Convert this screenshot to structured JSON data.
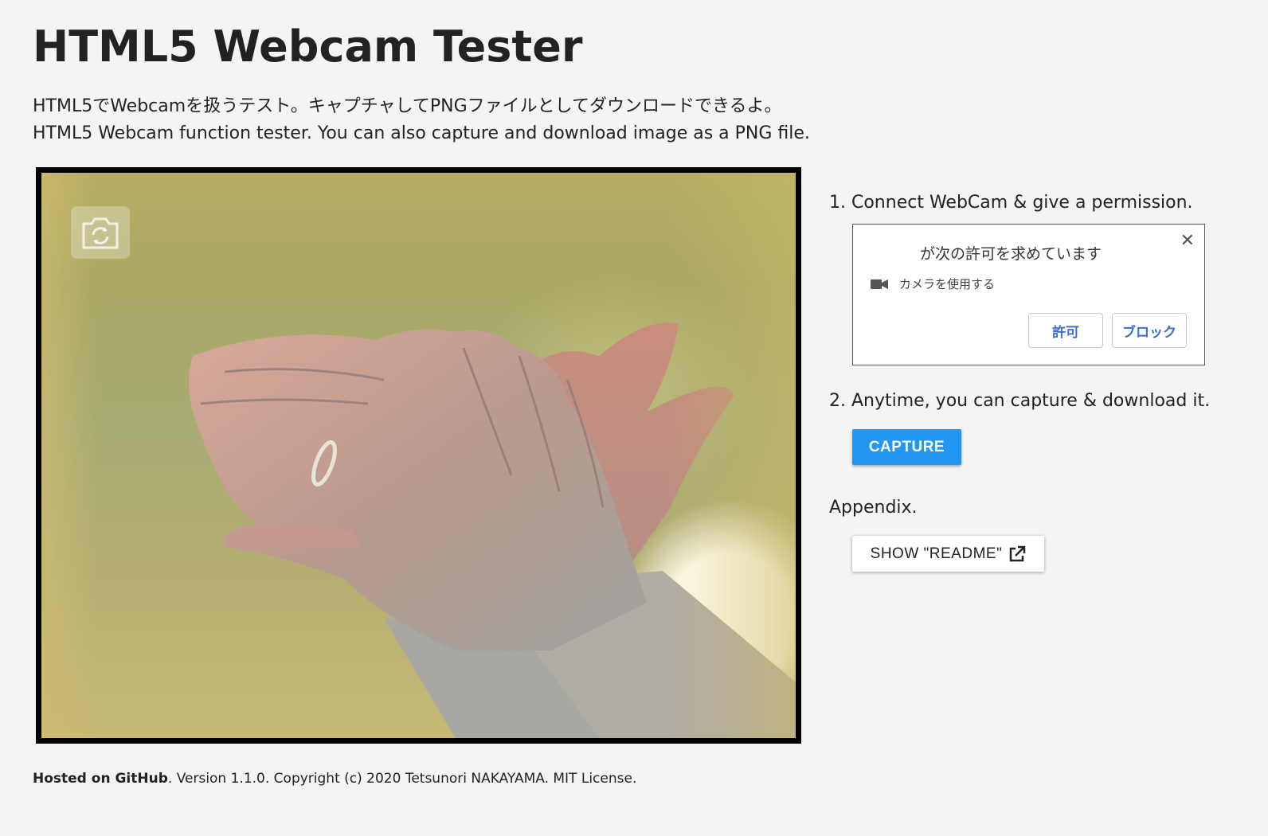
{
  "header": {
    "title": "HTML5 Webcam Tester",
    "description_ja": "HTML5でWebcamを扱うテスト。キャプチャしてPNGファイルとしてダウンロードできるよ。",
    "description_en": "HTML5 Webcam function tester. You can also capture and download image as a PNG file."
  },
  "video": {
    "camera_switch_icon": "camera-switch-icon"
  },
  "steps": {
    "step1": "1. Connect WebCam & give a permission.",
    "step2": "2. Anytime, you can capture & download it.",
    "appendix": "Appendix."
  },
  "permission_dialog": {
    "title": "が次の許可を求めています",
    "close": "✕",
    "item": "カメラを使用する",
    "allow": "許可",
    "block": "ブロック"
  },
  "buttons": {
    "capture": "CAPTURE",
    "readme": "SHOW \"README\""
  },
  "footer": {
    "link": "Hosted on GitHub",
    "text": ". Version 1.1.0. Copyright (c) 2020 Tetsunori NAKAYAMA. MIT License."
  },
  "colors": {
    "accent": "#2196f3",
    "background": "#f4f4f4",
    "dialog_link": "#3b6fd0"
  }
}
